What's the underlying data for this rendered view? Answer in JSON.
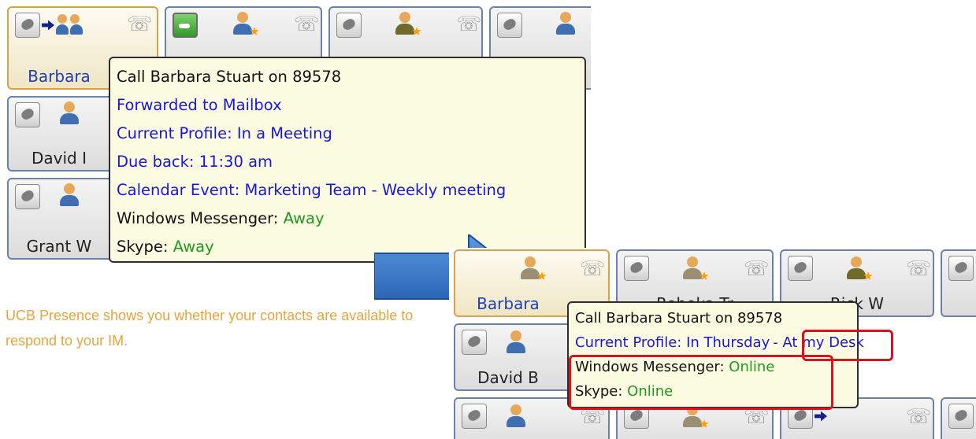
{
  "caption": "UCB Presence shows you whether your contacts are available to respond to your IM.",
  "top_panel": {
    "tiles": [
      {
        "name": "Barbara"
      },
      {
        "name": "David I"
      },
      {
        "name": "Grant W"
      }
    ],
    "tooltip": {
      "lines": [
        {
          "text": "Call Barbara Stuart on 89578",
          "color": "black"
        },
        {
          "text": "Forwarded to Mailbox",
          "color": "blue"
        },
        {
          "text": "Current Profile: In a Meeting",
          "color": "blue"
        },
        {
          "text": "Due back: 11:30 am",
          "color": "blue"
        },
        {
          "text": "Calendar Event: Marketing Team - Weekly meeting",
          "color": "blue"
        }
      ],
      "windows_messenger": {
        "label": "Windows Messenger: ",
        "status": "Away"
      },
      "skype": {
        "label": "Skype: ",
        "status": "Away"
      }
    }
  },
  "bottom_panel": {
    "tiles": [
      {
        "name": "Barbara"
      },
      {
        "name": "Rebeka Tr"
      },
      {
        "name": "Rick W"
      },
      {
        "name": "David B"
      }
    ],
    "tooltip": {
      "call_line": "Call Barbara Stuart on 89578",
      "profile_line": "Current Profile: In Thursday",
      "profile_suffix": "- At my Desk",
      "windows_messenger": {
        "label": "Windows Messenger: ",
        "status": "Online"
      },
      "skype": {
        "label": "Skype: ",
        "status": "Online"
      }
    }
  },
  "colors": {
    "status_blue": "#1a16d8",
    "status_green": "#1f9a1f",
    "highlight_red": "#d8121f",
    "caption_orange": "#e9a43a",
    "arrow_blue": "#2f6fc4"
  },
  "icons": [
    "phone-handset-icon",
    "forward-arrow-icon",
    "contact-pair-icon",
    "phone-jack-icon",
    "green-call-icon",
    "contact-icon",
    "away-star-icon",
    "blue-arrow"
  ]
}
